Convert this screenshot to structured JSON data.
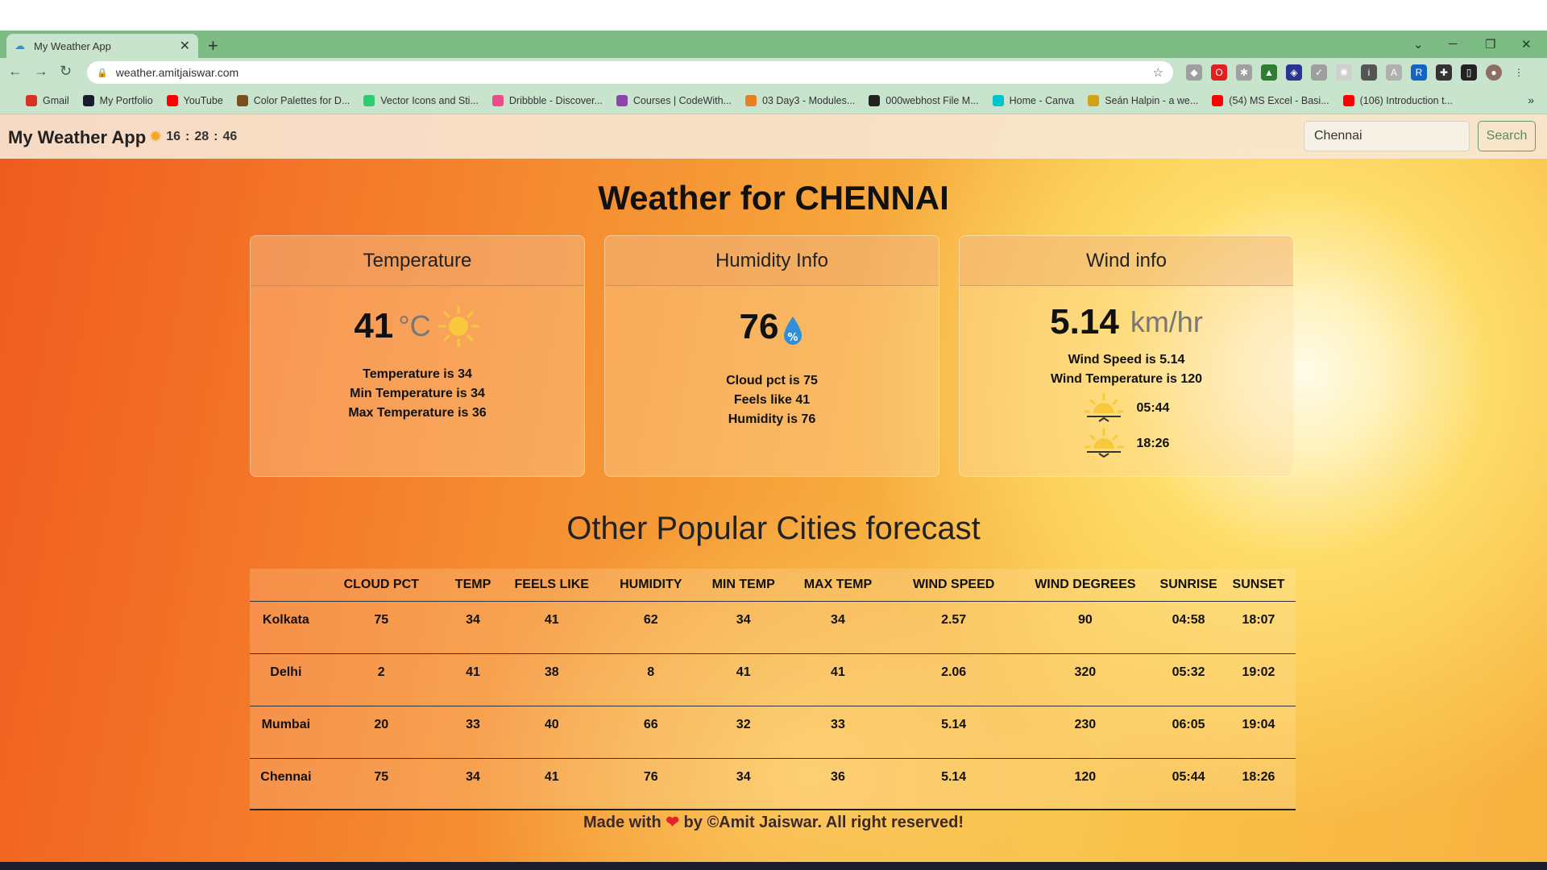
{
  "browser": {
    "tab_title": "My Weather App",
    "tab_close": "✕",
    "new_tab": "+",
    "url": "weather.amitjaiswar.com",
    "bookmarks": [
      {
        "label": "Gmail",
        "color": "#d93025"
      },
      {
        "label": "My Portfolio",
        "color": "#1a1a2e"
      },
      {
        "label": "YouTube",
        "color": "#ff0000"
      },
      {
        "label": "Color Palettes for D...",
        "color": "#7a4f1d"
      },
      {
        "label": "Vector Icons and Sti...",
        "color": "#2ecc71"
      },
      {
        "label": "Dribbble - Discover...",
        "color": "#ea4c89"
      },
      {
        "label": "Courses | CodeWith...",
        "color": "#8e44ad"
      },
      {
        "label": "03 Day3 - Modules...",
        "color": "#e67e22"
      },
      {
        "label": "000webhost File M...",
        "color": "#222222"
      },
      {
        "label": "Home - Canva",
        "color": "#00c4cc"
      },
      {
        "label": "Seán Halpin - a we...",
        "color": "#d4a017"
      },
      {
        "label": "(54) MS Excel - Basi...",
        "color": "#ff0000"
      },
      {
        "label": "(106) Introduction t...",
        "color": "#ff0000"
      }
    ]
  },
  "app": {
    "brand": "My Weather App",
    "clock": {
      "h": "16",
      "m": "28",
      "s": "46"
    },
    "search_value": "Chennai",
    "search_button": "Search",
    "title": "Weather for CHENNAI",
    "temperature": {
      "header": "Temperature",
      "value": "41",
      "unit": "°C",
      "lines": [
        "Temperature is 34",
        "Min Temperature is 34",
        "Max Temperature is 36"
      ]
    },
    "humidity": {
      "header": "Humidity Info",
      "value": "76",
      "lines": [
        "Cloud pct is 75",
        "Feels like 41",
        "Humidity is 76"
      ]
    },
    "wind": {
      "header": "Wind info",
      "value": "5.14",
      "unit": "km/hr",
      "lines": [
        "Wind Speed is 5.14",
        "Wind Temperature is 120"
      ],
      "sunrise": "05:44",
      "sunset": "18:26"
    },
    "section_title": "Other Popular Cities forecast",
    "table": {
      "columns": [
        "",
        "CLOUD PCT",
        "TEMP",
        "FEELS LIKE",
        "HUMIDITY",
        "MIN TEMP",
        "MAX TEMP",
        "WIND SPEED",
        "WIND DEGREES",
        "SUNRISE",
        "SUNSET"
      ],
      "rows": [
        [
          "Kolkata",
          "75",
          "34",
          "41",
          "62",
          "34",
          "34",
          "2.57",
          "90",
          "04:58",
          "18:07"
        ],
        [
          "Delhi",
          "2",
          "41",
          "38",
          "8",
          "41",
          "41",
          "2.06",
          "320",
          "05:32",
          "19:02"
        ],
        [
          "Mumbai",
          "20",
          "33",
          "40",
          "66",
          "32",
          "33",
          "5.14",
          "230",
          "06:05",
          "19:04"
        ],
        [
          "Chennai",
          "75",
          "34",
          "41",
          "76",
          "34",
          "36",
          "5.14",
          "120",
          "05:44",
          "18:26"
        ]
      ]
    },
    "footer": {
      "before": "Made with",
      "after": "by ©Amit Jaiswar. All right reserved!"
    }
  }
}
